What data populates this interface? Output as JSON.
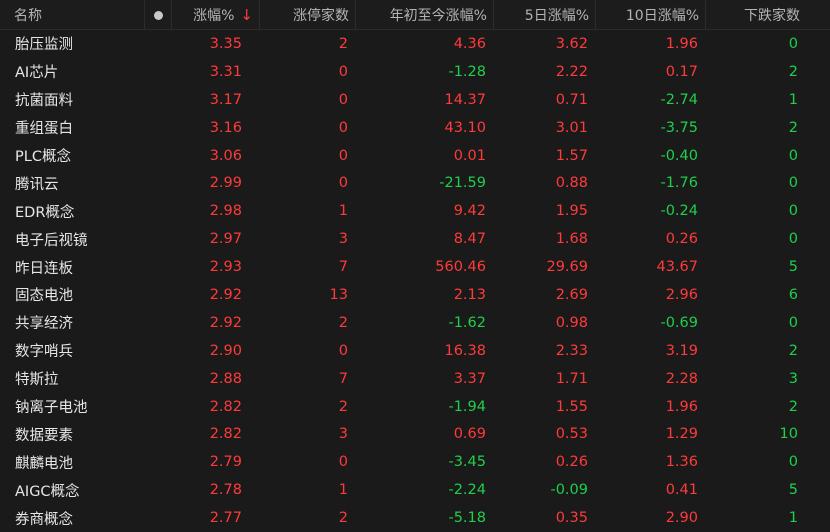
{
  "colors": {
    "up": "#ff3a3a",
    "down": "#1fcf4a",
    "background": "#1a1a1a",
    "header_text": "#b4b4b4"
  },
  "header": {
    "name": "名称",
    "dot_icon": "dot-icon",
    "change_pct": "涨幅%",
    "sort_icon": "arrow-down-icon",
    "sort_arrow": "↓",
    "limit_up_count": "涨停家数",
    "ytd_pct": "年初至今涨幅%",
    "d5_pct": "5日涨幅%",
    "d10_pct": "10日涨幅%",
    "down_count": "下跌家数"
  },
  "rows": [
    {
      "name": "胎压监测",
      "change": "3.35",
      "limit_up": "2",
      "ytd": "4.36",
      "d5": "3.62",
      "d10": "1.96",
      "down": "0"
    },
    {
      "name": "AI芯片",
      "change": "3.31",
      "limit_up": "0",
      "ytd": "-1.28",
      "d5": "2.22",
      "d10": "0.17",
      "down": "2"
    },
    {
      "name": "抗菌面料",
      "change": "3.17",
      "limit_up": "0",
      "ytd": "14.37",
      "d5": "0.71",
      "d10": "-2.74",
      "down": "1"
    },
    {
      "name": "重组蛋白",
      "change": "3.16",
      "limit_up": "0",
      "ytd": "43.10",
      "d5": "3.01",
      "d10": "-3.75",
      "down": "2"
    },
    {
      "name": "PLC概念",
      "change": "3.06",
      "limit_up": "0",
      "ytd": "0.01",
      "d5": "1.57",
      "d10": "-0.40",
      "down": "0"
    },
    {
      "name": "腾讯云",
      "change": "2.99",
      "limit_up": "0",
      "ytd": "-21.59",
      "d5": "0.88",
      "d10": "-1.76",
      "down": "0"
    },
    {
      "name": "EDR概念",
      "change": "2.98",
      "limit_up": "1",
      "ytd": "9.42",
      "d5": "1.95",
      "d10": "-0.24",
      "down": "0"
    },
    {
      "name": "电子后视镜",
      "change": "2.97",
      "limit_up": "3",
      "ytd": "8.47",
      "d5": "1.68",
      "d10": "0.26",
      "down": "0"
    },
    {
      "name": "昨日连板",
      "change": "2.93",
      "limit_up": "7",
      "ytd": "560.46",
      "d5": "29.69",
      "d10": "43.67",
      "down": "5"
    },
    {
      "name": "固态电池",
      "change": "2.92",
      "limit_up": "13",
      "ytd": "2.13",
      "d5": "2.69",
      "d10": "2.96",
      "down": "6"
    },
    {
      "name": "共享经济",
      "change": "2.92",
      "limit_up": "2",
      "ytd": "-1.62",
      "d5": "0.98",
      "d10": "-0.69",
      "down": "0"
    },
    {
      "name": "数字哨兵",
      "change": "2.90",
      "limit_up": "0",
      "ytd": "16.38",
      "d5": "2.33",
      "d10": "3.19",
      "down": "2"
    },
    {
      "name": "特斯拉",
      "change": "2.88",
      "limit_up": "7",
      "ytd": "3.37",
      "d5": "1.71",
      "d10": "2.28",
      "down": "3"
    },
    {
      "name": "钠离子电池",
      "change": "2.82",
      "limit_up": "2",
      "ytd": "-1.94",
      "d5": "1.55",
      "d10": "1.96",
      "down": "2"
    },
    {
      "name": "数据要素",
      "change": "2.82",
      "limit_up": "3",
      "ytd": "0.69",
      "d5": "0.53",
      "d10": "1.29",
      "down": "10"
    },
    {
      "name": "麒麟电池",
      "change": "2.79",
      "limit_up": "0",
      "ytd": "-3.45",
      "d5": "0.26",
      "d10": "1.36",
      "down": "0"
    },
    {
      "name": "AIGC概念",
      "change": "2.78",
      "limit_up": "1",
      "ytd": "-2.24",
      "d5": "-0.09",
      "d10": "0.41",
      "down": "5"
    },
    {
      "name": "券商概念",
      "change": "2.77",
      "limit_up": "2",
      "ytd": "-5.18",
      "d5": "0.35",
      "d10": "2.90",
      "down": "1"
    }
  ]
}
